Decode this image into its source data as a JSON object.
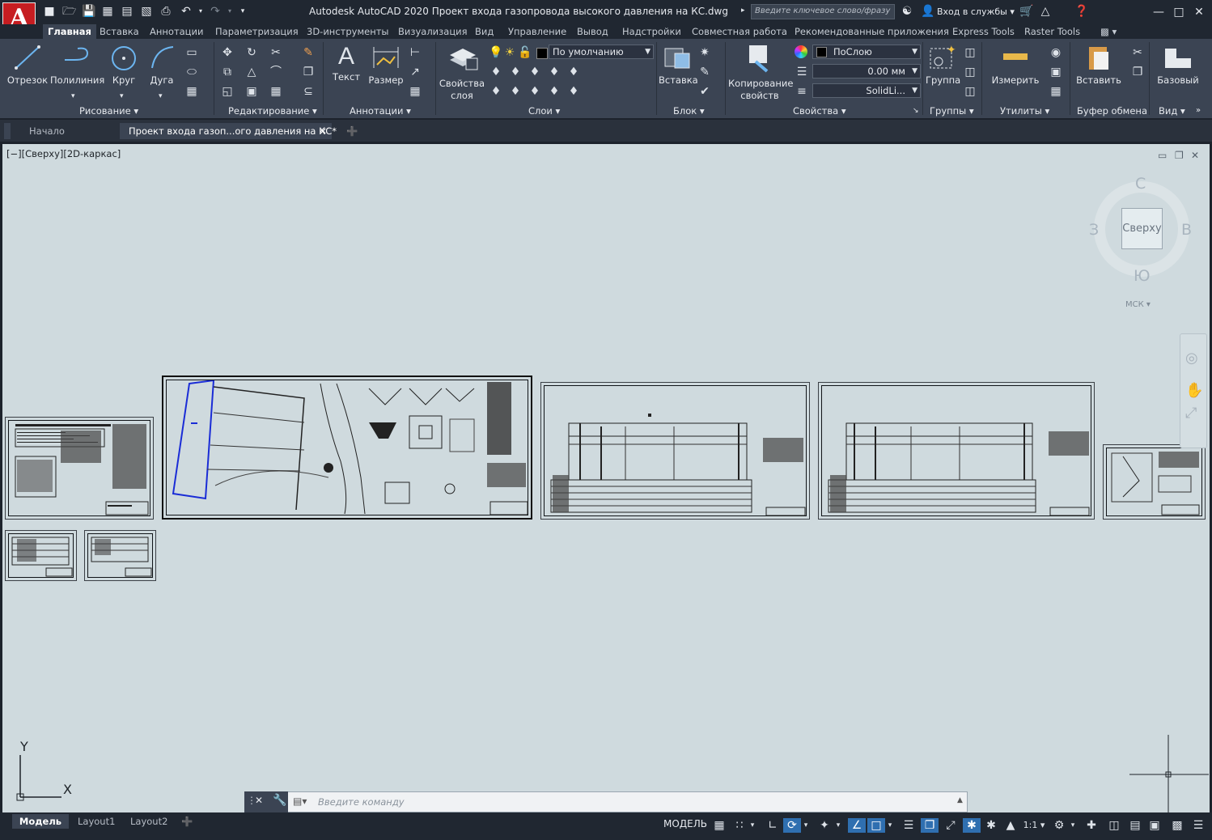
{
  "app": {
    "logo_letter": "A",
    "title": "Autodesk AutoCAD 2020   Проект входа газопровода высокого давления на КС.dwg",
    "search_placeholder": "Введите ключевое слово/фразу",
    "signin_label": "Вход в службы"
  },
  "ribbon_tabs": [
    "Главная",
    "Вставка",
    "Аннотации",
    "Параметризация",
    "3D-инструменты",
    "Визуализация",
    "Вид",
    "Управление",
    "Вывод",
    "Надстройки",
    "Совместная работа",
    "Рекомендованные приложения",
    "Express Tools",
    "Raster Tools"
  ],
  "ribbon": {
    "draw": {
      "title": "Рисование",
      "line": "Отрезок",
      "polyline": "Полилиния",
      "circle": "Круг",
      "arc": "Дуга"
    },
    "modify": {
      "title": "Редактирование"
    },
    "annotation": {
      "title": "Аннотации",
      "text": "Текст",
      "dimension": "Размер"
    },
    "layers": {
      "title": "Слои",
      "properties_line1": "Свойства",
      "properties_line2": "слоя",
      "current_layer": "По умолчанию"
    },
    "block": {
      "title": "Блок",
      "insert": "Вставка"
    },
    "properties": {
      "title": "Свойства",
      "match_line1": "Копирование",
      "match_line2": "свойств",
      "color": "ПоСлою",
      "lineweight": "0.00 мм",
      "linetype": "SolidLi..."
    },
    "groups": {
      "title": "Группы",
      "group": "Группа"
    },
    "utilities": {
      "title": "Утилиты",
      "measure": "Измерить"
    },
    "clipboard": {
      "title": "Буфер обмена",
      "paste": "Вставить"
    },
    "view": {
      "title": "Вид",
      "base": "Базовый"
    }
  },
  "file_tabs": {
    "start": "Начало",
    "document": "Проект входа газоп...ого давления на КС*"
  },
  "viewport": {
    "label": "[−][Сверху][2D-каркас]",
    "cube_face": "Сверху",
    "compass_n": "С",
    "compass_s": "Ю",
    "compass_w": "З",
    "compass_e": "В",
    "ucs": "МСК",
    "axis_x": "X",
    "axis_y": "Y"
  },
  "command": {
    "placeholder": "Введите команду"
  },
  "layout_tabs": [
    "Модель",
    "Layout1",
    "Layout2"
  ],
  "status": {
    "model": "МОДЕЛЬ",
    "scale": "1:1"
  },
  "colors": {
    "accent": "#2f6fb0",
    "logo": "#c61d21",
    "canvas": "#cfdade",
    "ribbon": "#3b4453"
  }
}
